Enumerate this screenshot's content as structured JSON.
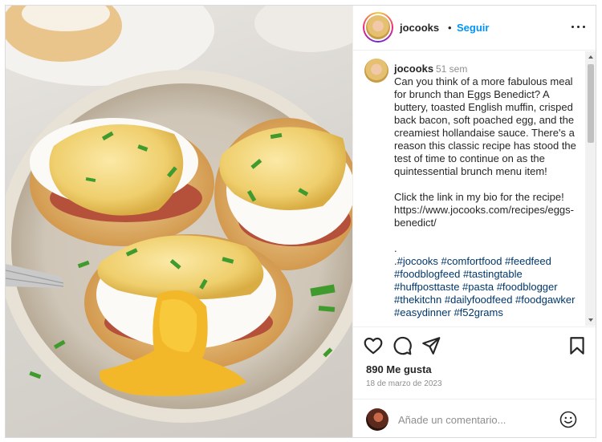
{
  "post": {
    "image_alt": "Eggs Benedict"
  },
  "header": {
    "username": "jocooks",
    "separator": "•",
    "follow_label": "Seguir"
  },
  "caption": {
    "username": "jocooks",
    "time": "51 sem",
    "text": "Can you think of a more fabulous meal for brunch than Eggs Benedict? A buttery, toasted English muffin, crisped back bacon, soft poached egg, and the creamiest hollandaise sauce. There's a reason this classic recipe has stood the test of time to continue on as the quintessential brunch menu item!\n\nClick the link in my bio for the recipe! https://www.jocooks.com/recipes/eggs-benedict/\n\n.\n.",
    "hashtags": "#jocooks #comfortfood #feedfeed #foodblogfeed #tastingtable #huffposttaste #pasta #foodblogger #thekitchn #dailyfoodfeed #foodgawker #easydinner #f52grams"
  },
  "actions": {
    "icons": [
      "heart-icon",
      "comment-icon",
      "share-icon",
      "bookmark-icon"
    ],
    "likes": "890 Me gusta",
    "date": "18 de marzo de 2023"
  },
  "add_comment": {
    "placeholder": "Añade un comentario..."
  },
  "colors": {
    "link_blue": "#0095f6",
    "hashtag_blue": "#00376b",
    "text": "#262626",
    "muted": "#8e8e8e"
  }
}
